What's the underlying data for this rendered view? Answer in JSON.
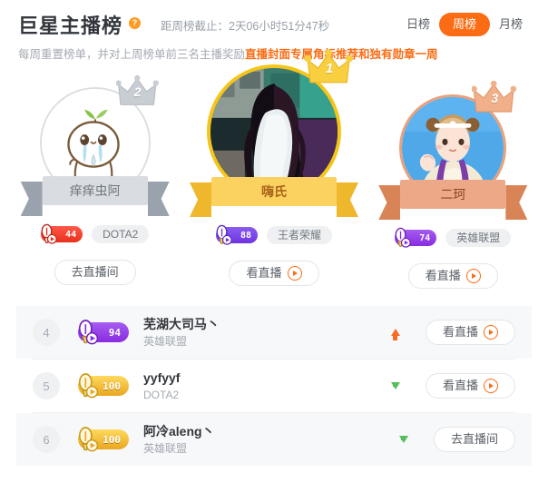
{
  "header": {
    "title": "巨星主播榜",
    "help_icon": "question-mark-icon",
    "countdown": "距周榜截止：2天06小时51分47秒",
    "subtitle_plain": "每周重置榜单，并对上周榜单前三名主播奖励",
    "subtitle_highlight": "直播封面专属角标推荐和独有勋章一周",
    "tabs": [
      {
        "label": "日榜",
        "active": false
      },
      {
        "label": "周榜",
        "active": true
      },
      {
        "label": "月榜",
        "active": false
      }
    ],
    "accent_color": "#fb6c14"
  },
  "podium": {
    "first": {
      "rank": "1",
      "name": "嗨氏",
      "level": "88",
      "game": "王者荣耀",
      "button": "看直播",
      "has_play_icon": true,
      "crown_color": "#f5c518",
      "ribbon_color": "#fbd25f",
      "badge_color": "#6f35e0"
    },
    "second": {
      "rank": "2",
      "name": "痒痒虫阿",
      "level": "44",
      "game": "DOTA2",
      "button": "去直播间",
      "has_play_icon": false,
      "crown_color": "#c9ced4",
      "ribbon_color": "#d9dde2",
      "badge_color": "#e8301c"
    },
    "third": {
      "rank": "3",
      "name": "二珂",
      "level": "74",
      "game": "英雄联盟",
      "button": "看直播",
      "has_play_icon": true,
      "crown_color": "#f0a87f",
      "ribbon_color": "#eda987",
      "badge_color": "#8a2be2"
    }
  },
  "list": {
    "rows": [
      {
        "rank": "4",
        "level": "94",
        "badge_style": "purple",
        "name": "芜湖大司马丶",
        "game": "英雄联盟",
        "trend": "up",
        "button": "看直播",
        "has_play_icon": true
      },
      {
        "rank": "5",
        "level": "100",
        "badge_style": "gold",
        "name": "yyfyyf",
        "game": "DOTA2",
        "trend": "down",
        "button": "看直播",
        "has_play_icon": true
      },
      {
        "rank": "6",
        "level": "100",
        "badge_style": "gold",
        "name": "阿冷aleng丶",
        "game": "英雄联盟",
        "trend": "down",
        "button": "去直播间",
        "has_play_icon": false
      }
    ]
  }
}
